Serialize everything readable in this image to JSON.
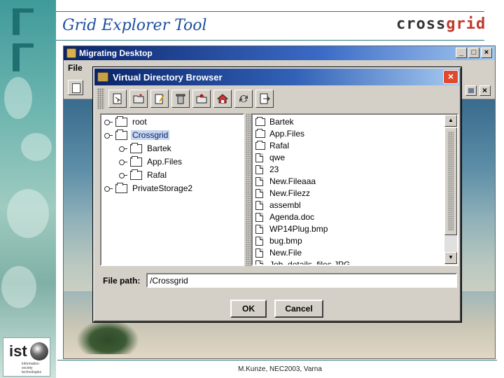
{
  "slide": {
    "title": "Grid Explorer Tool",
    "logo_text_a": "cross",
    "logo_text_b": "grid",
    "ist_logo": "ist",
    "ist_small": "information society technologies",
    "footer": "M.Kunze, NEC2003, Varna"
  },
  "desktop": {
    "title": "Migrating Desktop",
    "menu_file": "File",
    "window_buttons": [
      "_",
      "□",
      "×"
    ]
  },
  "dialog": {
    "title": "Virtual Directory Browser",
    "close_label": "×",
    "toolbar_icons": [
      "select-icon",
      "new-folder-icon",
      "edit-icon",
      "delete-icon",
      "up-folder-icon",
      "home-folder-icon",
      "refresh-icon",
      "exit-icon"
    ],
    "tree": [
      {
        "label": "root",
        "selected": false
      },
      {
        "label": "Crossgrid",
        "selected": true
      },
      {
        "label": "Bartek",
        "selected": false
      },
      {
        "label": "App.Files",
        "selected": false
      },
      {
        "label": "Rafal",
        "selected": false
      },
      {
        "label": "PrivateStorage2",
        "selected": false
      }
    ],
    "files": [
      {
        "name": "Bartek",
        "type": "folder"
      },
      {
        "name": "App.Files",
        "type": "folder"
      },
      {
        "name": "Rafal",
        "type": "folder"
      },
      {
        "name": "qwe",
        "type": "file"
      },
      {
        "name": "23",
        "type": "file"
      },
      {
        "name": "New.Fileaaa",
        "type": "file"
      },
      {
        "name": "New.Filezz",
        "type": "file"
      },
      {
        "name": "assembl",
        "type": "file"
      },
      {
        "name": "Agenda.doc",
        "type": "file"
      },
      {
        "name": "WP14Plug.bmp",
        "type": "file"
      },
      {
        "name": "bug.bmp",
        "type": "file"
      },
      {
        "name": "New.File",
        "type": "file"
      },
      {
        "name": "Job_details_files.JPG",
        "type": "file"
      }
    ],
    "path_label": "File path:",
    "path_value": "/Crossgrid",
    "ok_label": "OK",
    "cancel_label": "Cancel"
  }
}
